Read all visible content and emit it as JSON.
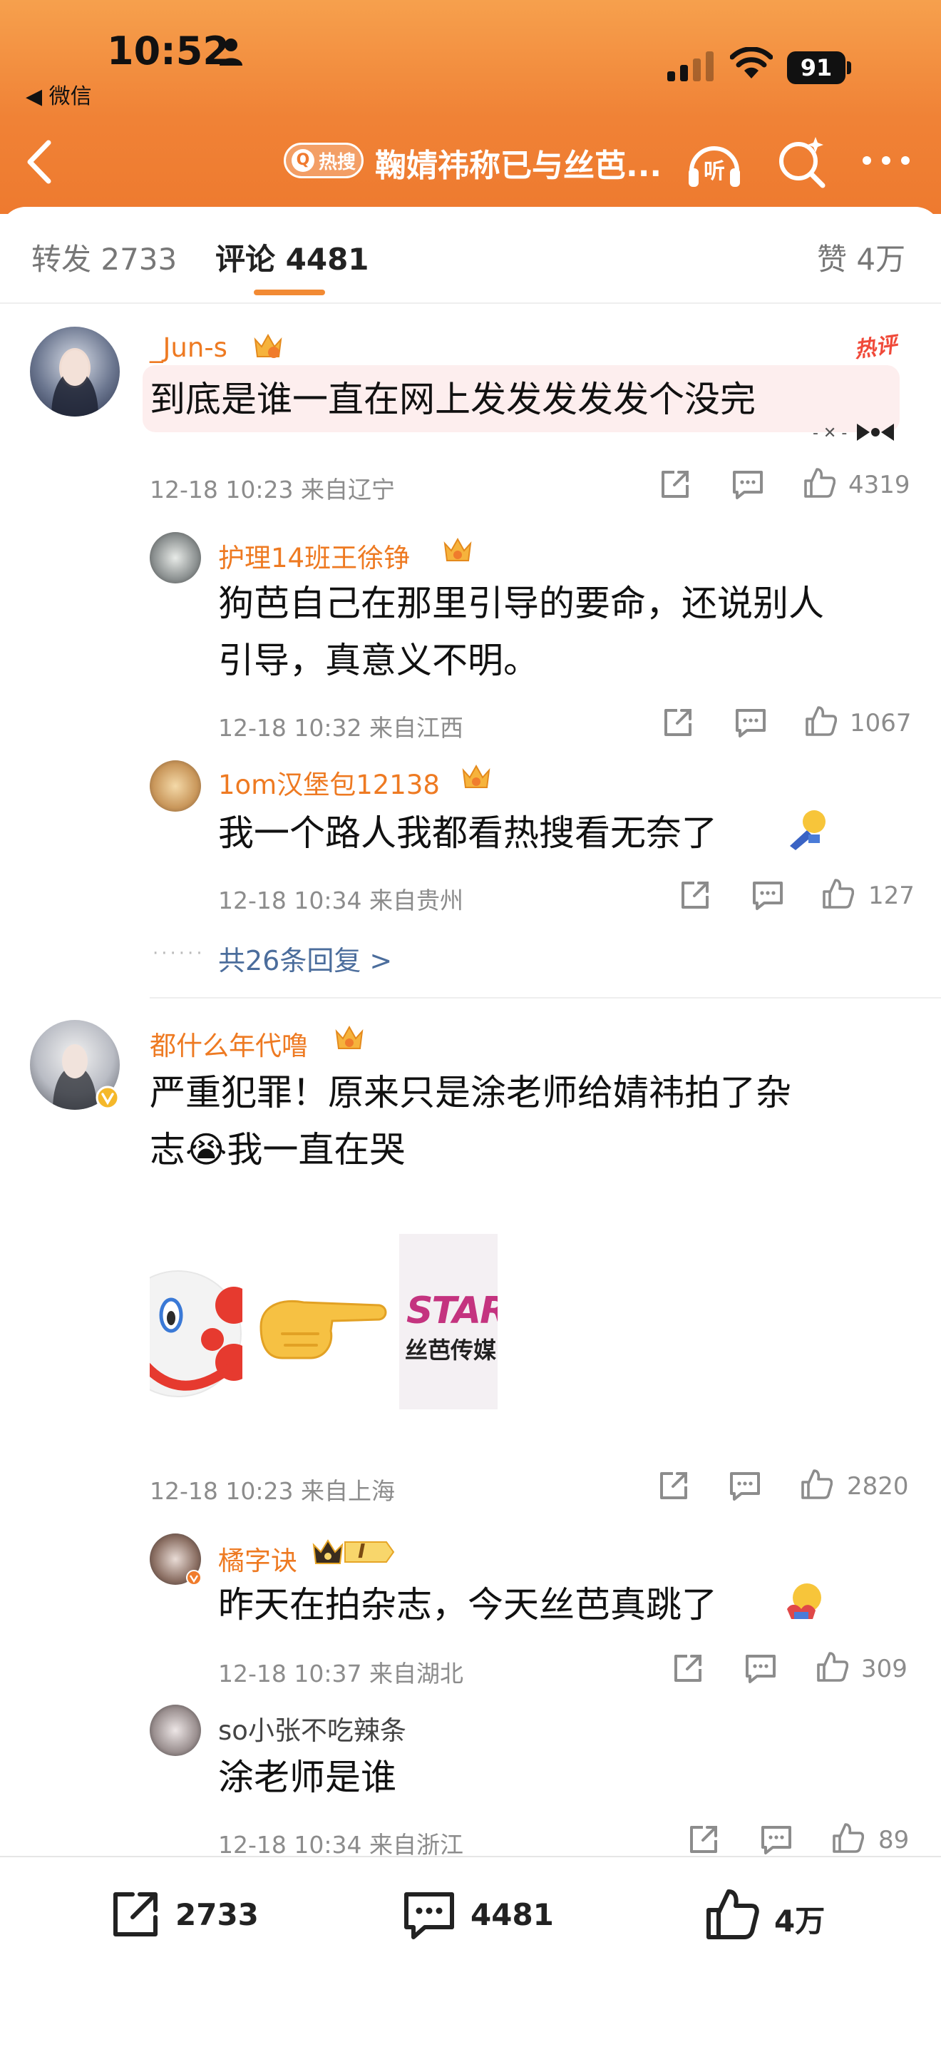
{
  "statusbar": {
    "time": "10:52",
    "back_app": "◀ 微信",
    "battery": "91"
  },
  "navbar": {
    "hot_badge": "热搜",
    "title": "鞠婧祎称已与丝芭..."
  },
  "tabs": {
    "repost": "转发 2733",
    "comments": "评论 4481",
    "likes": "赞 4万"
  },
  "comments": [
    {
      "user": "_Jun-s",
      "text": "到底是谁一直在网上发发发发发个没完",
      "hot_tag": "热评",
      "meta": "12-18 10:23 来自辽宁",
      "likes": "4319",
      "replies": [
        {
          "user": "护理14班王徐铮",
          "text_line1": "狗芭自己在那里引导的要命，还说别人",
          "text_line2": "引导，真意义不明。",
          "meta": "12-18 10:32 来自江西",
          "likes": "1067"
        },
        {
          "user": "1om汉堡包12138",
          "text": "我一个路人我都看热搜看无奈了",
          "meta": "12-18 10:34 来自贵州",
          "likes": "127"
        }
      ],
      "more_replies": "共26条回复 >"
    },
    {
      "user": "都什么年代噜",
      "text_line1": "严重犯罪！原来只是涂老师给婧祎拍了杂",
      "text_line2": "志😭我一直在哭",
      "sticker_text_top": "STAR",
      "sticker_text_bottom": "丝芭传媒",
      "meta": "12-18 10:23 来自上海",
      "likes": "2820",
      "replies": [
        {
          "user": "橘字诀",
          "level": "I",
          "text": "昨天在拍杂志，今天丝芭真跳了",
          "meta": "12-18 10:37 来自湖北",
          "likes": "309"
        },
        {
          "user": "so小张不吃辣条",
          "text": "涂老师是谁",
          "meta": "12-18 10:34 来自浙江",
          "likes": "89"
        }
      ]
    }
  ],
  "bottombar": {
    "repost": "2733",
    "comment": "4481",
    "like": "4万"
  },
  "colors": {
    "header_top": "#f6a04d",
    "header_bottom": "#ee7a2f",
    "username": "#ee7a22",
    "link": "#4b6d9c",
    "hot_tag": "#f04a3a"
  }
}
